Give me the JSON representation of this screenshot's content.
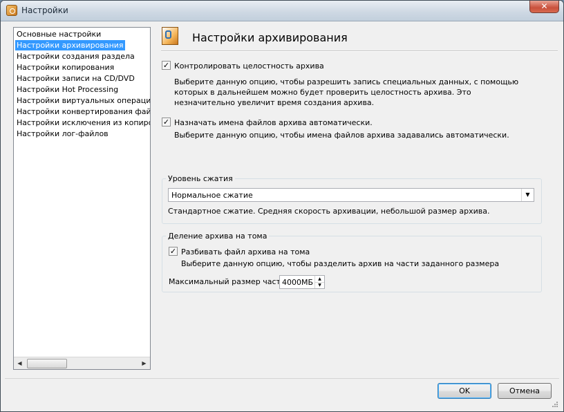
{
  "window": {
    "title": "Настройки",
    "close_glyph": "✕",
    "app_icon": "archive-settings-icon"
  },
  "sidebar": {
    "items": [
      {
        "label": "Основные настройки",
        "selected": false
      },
      {
        "label": "Настройки архивирования",
        "selected": true
      },
      {
        "label": "Настройки создания раздела",
        "selected": false
      },
      {
        "label": "Настройки копирования",
        "selected": false
      },
      {
        "label": "Настройки записи на CD/DVD",
        "selected": false
      },
      {
        "label": "Настройки Hot Processing",
        "selected": false
      },
      {
        "label": "Настройки виртуальных операций",
        "selected": false
      },
      {
        "label": "Настройки конвертирования файлов",
        "selected": false
      },
      {
        "label": "Настройки исключения из копирования",
        "selected": false
      },
      {
        "label": "Настройки лог-файлов",
        "selected": false
      }
    ],
    "scroll_left": "◀",
    "scroll_right": "▶"
  },
  "main": {
    "title": "Настройки архивирования",
    "verify": {
      "checked": true,
      "label": "Контролировать целостность архива",
      "description": "Выберите данную опцию, чтобы разрешить запись специальных данных, с помощью которых в дальнейшем можно будет проверить целостность архива. Это незначительно увеличит время создания архива."
    },
    "auto_names": {
      "checked": true,
      "label": "Назначать имена файлов архива автоматически.",
      "description": "Выберите данную опцию, чтобы имена файлов архива задавались автоматически."
    },
    "compression": {
      "legend": "Уровень сжатия",
      "selected": "Нормальное сжатие",
      "description": "Стандартное сжатие. Средняя скорость архивации, небольшой размер архива."
    },
    "split": {
      "legend": "Деление архива на тома",
      "checked": true,
      "label": "Разбивать файл архива на тома",
      "description": "Выберите данную опцию, чтобы разделить архив на части заданного размера",
      "max_size_label": "Максимальный размер части:",
      "max_size_value": "4000МБ"
    }
  },
  "footer": {
    "ok_label": "OK",
    "cancel_label": "Отмена"
  },
  "glyphs": {
    "check": "✓",
    "dropdown": "▼",
    "spin_up": "▲",
    "spin_down": "▼"
  }
}
